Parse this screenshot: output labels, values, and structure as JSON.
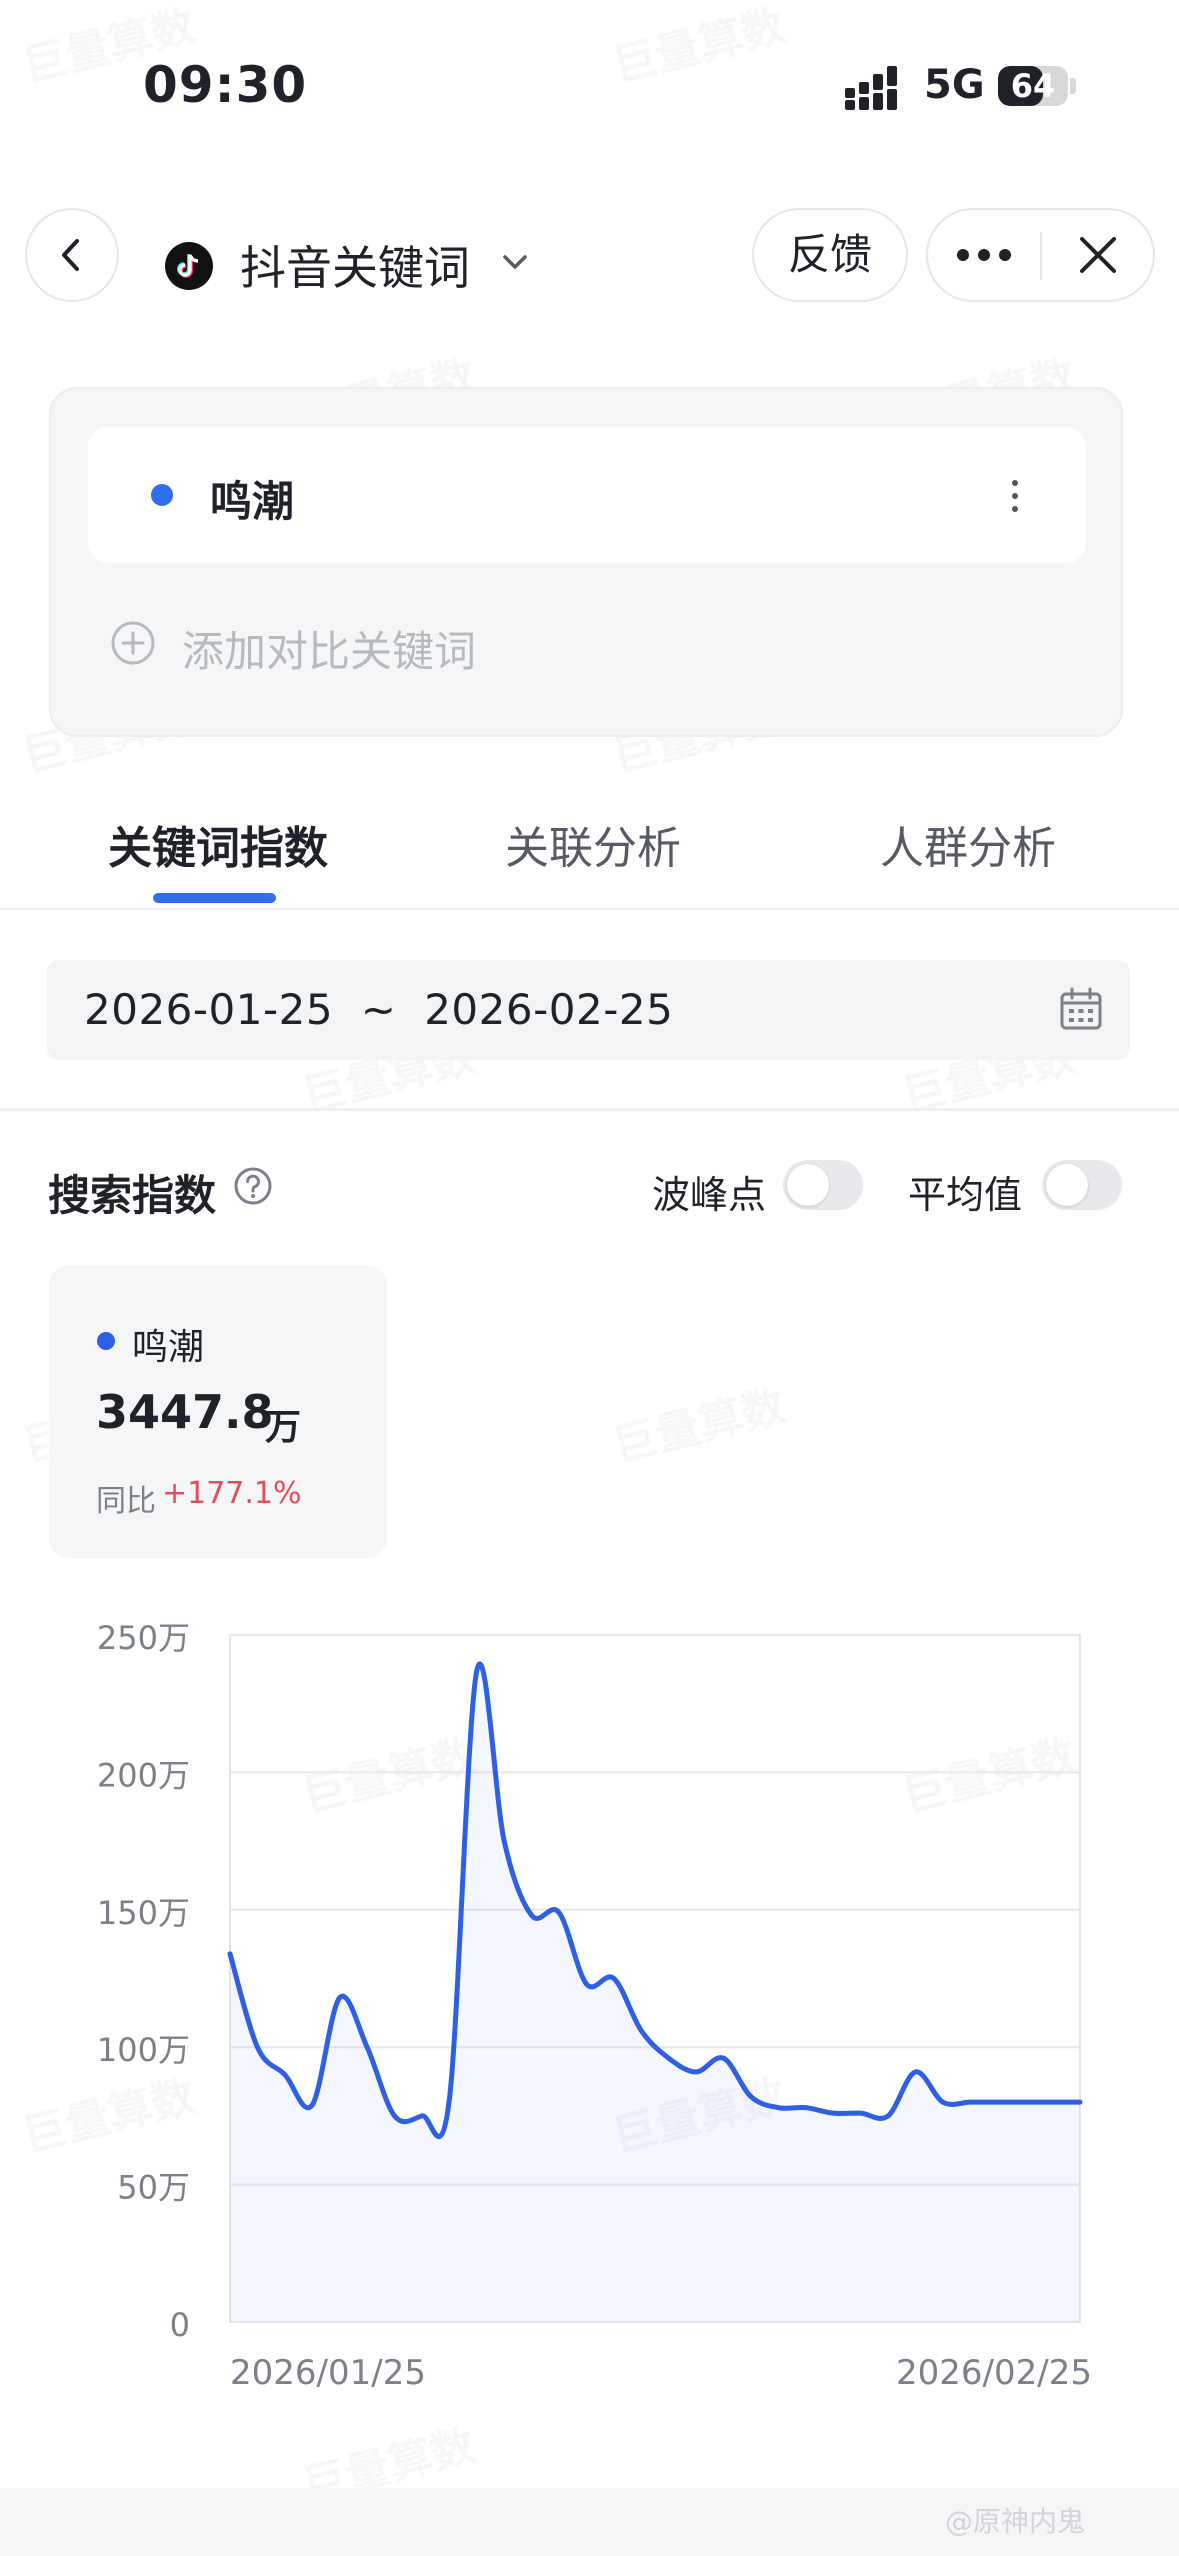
{
  "status_bar": {
    "time": "09:30",
    "network": "5G",
    "battery": "64",
    "battery_level": 0.64
  },
  "header": {
    "title": "抖音关键词",
    "feedback_label": "反馈"
  },
  "keywords": {
    "items": [
      {
        "name": "鸣潮",
        "color": "#2f6fec"
      }
    ],
    "add_placeholder": "添加对比关键词"
  },
  "tabs": [
    {
      "label": "关键词指数",
      "active": true
    },
    {
      "label": "关联分析"
    },
    {
      "label": "人群分析"
    }
  ],
  "date_range": {
    "start": "2026-01-25",
    "separator": "~",
    "end": "2026-02-25"
  },
  "search_index": {
    "title": "搜索指数",
    "toggles": [
      {
        "label": "波峰点",
        "on": false
      },
      {
        "label": "平均值",
        "on": false
      }
    ],
    "summary": {
      "keyword": "鸣潮",
      "value": "3447.8",
      "unit": "万",
      "yoy_label": "同比",
      "yoy_value": "+177.1%"
    }
  },
  "watermark": "巨量算数",
  "footer_watermark": "@原神内鬼 ",
  "chart_data": {
    "type": "line",
    "x_tick_labels": [
      "2026/01/25",
      "2026/02/25"
    ],
    "y_tick_labels": [
      "250万",
      "200万",
      "150万",
      "100万",
      "50万",
      "0"
    ],
    "ylim": [
      0,
      250
    ],
    "y_unit": "万",
    "grid": true,
    "series": [
      {
        "color": "#2f5fe3",
        "x": [
          "2026-01-25",
          "2026-01-26",
          "2026-01-27",
          "2026-01-28",
          "2026-01-29",
          "2026-01-30",
          "2026-01-31",
          "2026-02-01",
          "2026-02-02",
          "2026-02-03",
          "2026-02-04",
          "2026-02-05",
          "2026-02-06",
          "2026-02-07",
          "2026-02-08",
          "2026-02-09",
          "2026-02-10",
          "2026-02-11",
          "2026-02-12",
          "2026-02-13",
          "2026-02-14",
          "2026-02-15",
          "2026-02-16",
          "2026-02-17",
          "2026-02-18",
          "2026-02-19",
          "2026-02-20",
          "2026-02-21",
          "2026-02-22",
          "2026-02-23",
          "2026-02-24",
          "2026-02-25"
        ],
        "values": [
          134,
          100,
          90,
          79,
          118,
          100,
          75,
          75,
          81,
          237,
          175,
          148,
          149,
          123,
          125,
          106,
          96,
          91,
          96,
          82,
          78,
          78,
          76,
          76,
          75,
          91,
          80,
          80,
          80,
          80,
          80,
          80
        ]
      }
    ]
  }
}
